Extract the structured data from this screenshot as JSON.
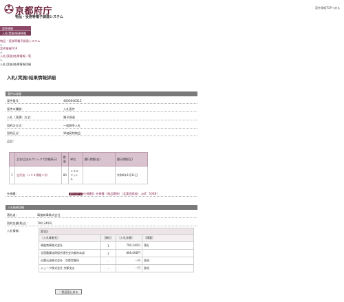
{
  "header": {
    "site_title": "京都府庁",
    "subtitle": "物品・役務等電子調達システム",
    "top_link": "案件情報TOPへ戻る"
  },
  "menu": {
    "items": [
      {
        "label": "案件情報"
      },
      {
        "label": "入札(実施)結果情報"
      }
    ]
  },
  "breadcrumbs": {
    "system": "物品・役務等電子調達システム",
    "sep": ">",
    "top": "案件情報TOP",
    "list": "入札(実施)結果情報一覧",
    "current": "入札(実施)結果情報詳細"
  },
  "page_title": "入札(実施)結果情報詳細",
  "case_section": {
    "title": "案件の詳細",
    "rows": [
      {
        "label": "案件番号：",
        "value": "4000006315"
      },
      {
        "label": "案件の種類：",
        "value": "入札案件"
      },
      {
        "label": "入札（見積）方法：",
        "value": "電子調達"
      },
      {
        "label": "契約の方法：",
        "value": "一般競争入札"
      },
      {
        "label": "契約区分：",
        "value": "単価契約物品"
      },
      {
        "label": "品目：",
        "value": ""
      }
    ]
  },
  "items_table": {
    "headers": [
      "",
      "品名(品名をクリックで詳細表示)",
      "数量",
      "単位",
      "履行期間(自)",
      "履行期間(至)"
    ],
    "rows": [
      {
        "no": "1",
        "name": "白灯油（ＪＩＳ規格１号）",
        "qty": "80",
        "unit": "１００リットル",
        "from": "",
        "to": "令和6年1月31日"
      }
    ]
  },
  "spec": {
    "label": "仕様書：",
    "badge": "ダウンロード",
    "value": "仕様書(1 仕様書（物品関係）（北桑田高校）.pdf：50KB）"
  },
  "result_section": {
    "title": "入札結果詳細",
    "rows": [
      {
        "label": "落札者：",
        "value": "晴嵐商事株式会社"
      },
      {
        "label": "契約金額(税込)：",
        "value": "790,240円"
      },
      {
        "label": "入札情報：",
        "value": ""
      }
    ]
  },
  "results": {
    "round": "第1回",
    "headers": [
      "［入札業者名］",
      "［順位］",
      "［入札金額］",
      "［摘要］"
    ],
    "rows": [
      {
        "name": "晴嵐商事株式会社",
        "rank": "1",
        "amount": "790,240円",
        "note": "落札"
      },
      {
        "name": "全国農業協同組合連合会京都府本部",
        "rank": "2",
        "amount": "866,008円",
        "note": ""
      },
      {
        "name": "出雲石油株式会社　京都営業所",
        "rank": "-",
        "amount": "－円",
        "note": "辞退"
      },
      {
        "name": "シェーワ株式会社 京都支店",
        "rank": "-",
        "amount": "－円",
        "note": "辞退"
      }
    ]
  },
  "back_button": "一覧画面に戻る",
  "colors": {
    "brand": "#6b1f3a",
    "menu": "#8c4a68",
    "section": "#7a7a7a",
    "table_head": "#d9c3cf"
  }
}
